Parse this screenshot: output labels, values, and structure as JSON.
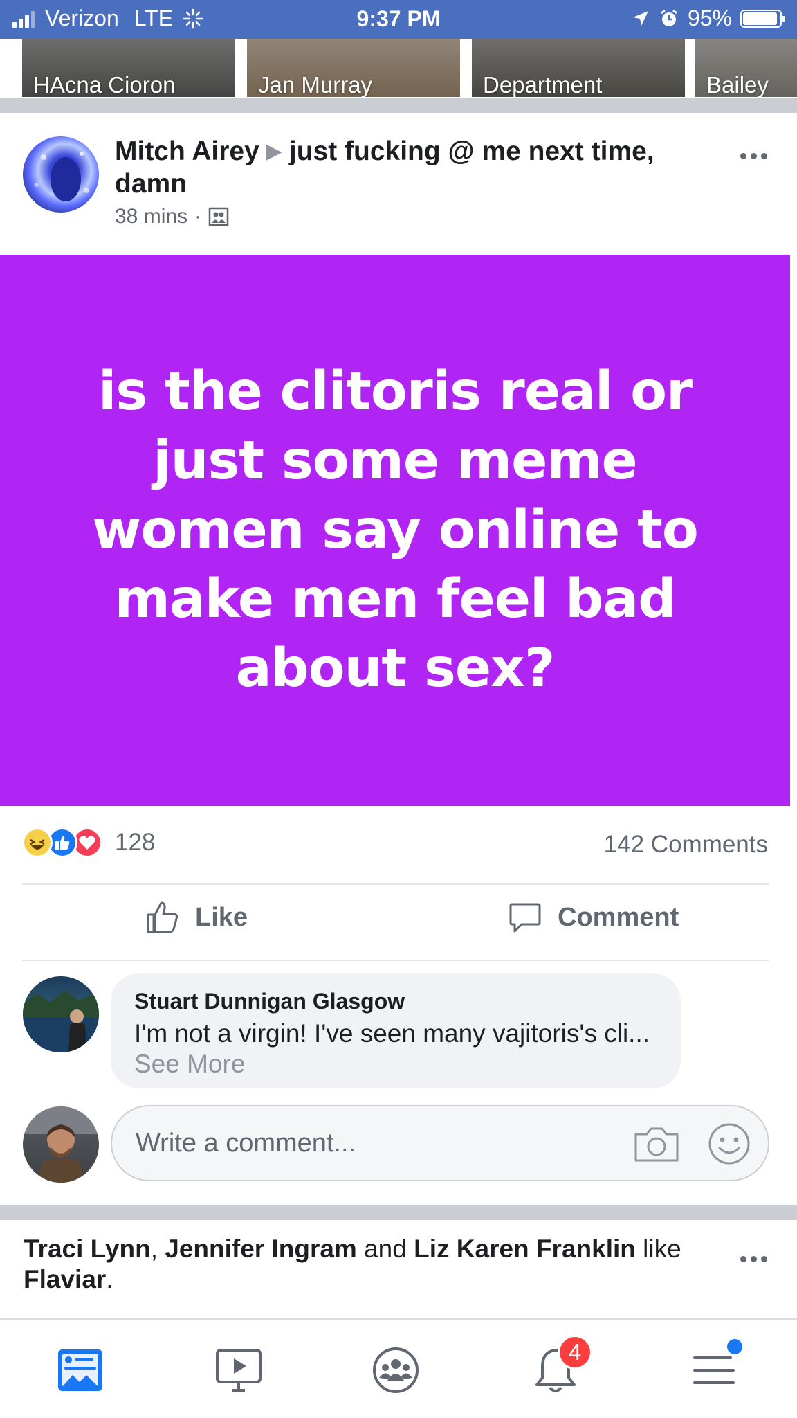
{
  "status_bar": {
    "carrier": "Verizon",
    "network": "LTE",
    "time": "9:37 PM",
    "battery": "95%",
    "battery_level": 0.95
  },
  "stories": [
    {
      "name": "HAcna Cioron",
      "color": "#3a3a38"
    },
    {
      "name": "Jan Murray",
      "color": "#6b5a45"
    },
    {
      "name": "Department",
      "color": "#3d3b36"
    },
    {
      "name": "Bailey",
      "color": "#5c5a55"
    }
  ],
  "post": {
    "author": "Mitch Airey",
    "title": "just fucking @ me next time, damn",
    "time": "38 mins",
    "privacy_icon": "friends-list-icon",
    "body": "is the clitoris real or just some meme women say online to make men feel bad about sex?",
    "background_color": "#b025f3"
  },
  "reactions": {
    "types": [
      "haha",
      "like",
      "love"
    ],
    "count": "128",
    "comments": "142 Comments"
  },
  "actions": {
    "like": "Like",
    "comment": "Comment"
  },
  "comment": {
    "author": "Stuart Dunnigan Glasgow",
    "text": "I'm not a virgin! I've seen many vajitoris's cli",
    "ellipsis": "...",
    "see_more": "See More"
  },
  "write_comment": {
    "placeholder": "Write a comment..."
  },
  "next_story": {
    "name1": "Traci Lynn",
    "sep1": ", ",
    "name2": "Jennifer Ingram",
    "sep2": " and ",
    "name3": "Liz Karen Franklin",
    "verb": " like ",
    "page": "Flaviar",
    "end": "."
  },
  "tab_bar": {
    "notifications_badge": "4",
    "items": [
      "news-feed-icon",
      "watch-icon",
      "groups-icon",
      "notifications-icon",
      "menu-icon"
    ]
  }
}
